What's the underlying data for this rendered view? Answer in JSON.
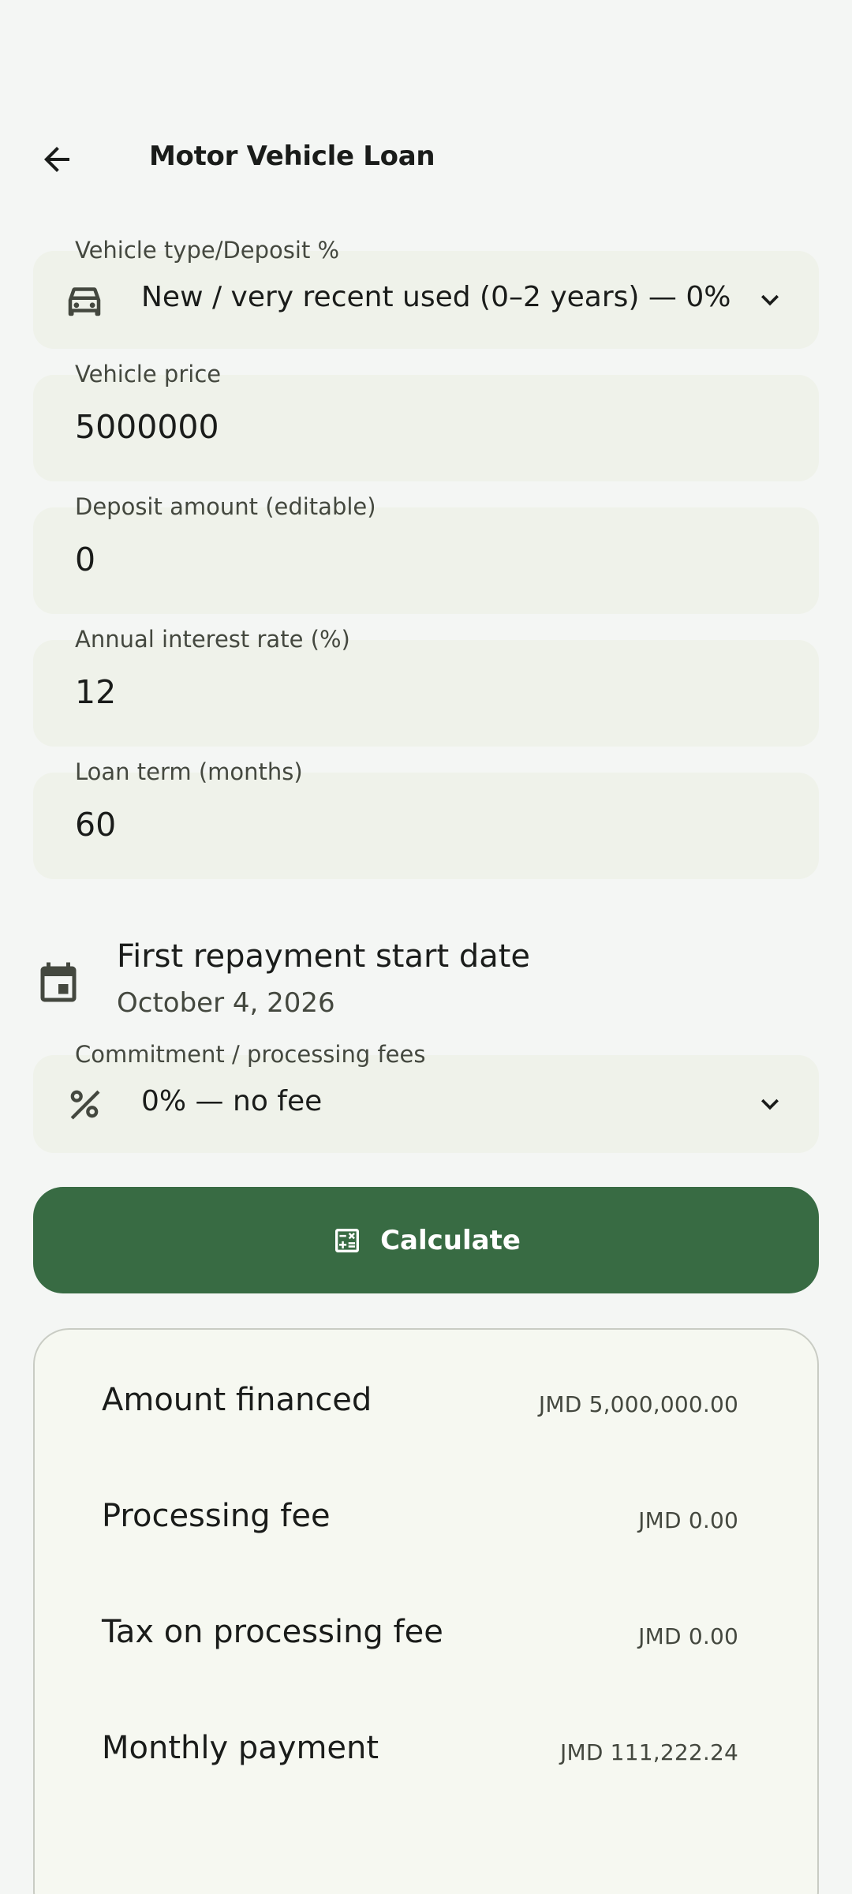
{
  "header": {
    "title": "Motor Vehicle Loan",
    "back_icon": "arrow-left-icon"
  },
  "vehicle_type": {
    "label": "Vehicle type/Deposit %",
    "value": "New / very recent used (0–2 years) — 0%",
    "icon": "car-icon"
  },
  "vehicle_price": {
    "label": "Vehicle price",
    "value": "5000000"
  },
  "deposit": {
    "label": "Deposit amount (editable)",
    "value": "0"
  },
  "interest": {
    "label": "Annual interest rate (%)",
    "value": "12"
  },
  "term": {
    "label": "Loan term (months)",
    "value": "60"
  },
  "start_date": {
    "title": "First repayment start date",
    "value": "October 4, 2026",
    "icon": "calendar-icon"
  },
  "fees": {
    "label": "Commitment / processing fees",
    "value": "0% — no fee",
    "icon": "percent-icon"
  },
  "calculate": {
    "label": "Calculate",
    "icon": "calculator-icon"
  },
  "results": [
    {
      "label": "Amount financed",
      "value": "JMD 5,000,000.00"
    },
    {
      "label": "Processing fee",
      "value": "JMD 0.00"
    },
    {
      "label": "Tax on processing fee",
      "value": "JMD 0.00"
    },
    {
      "label": "Monthly payment",
      "value": "JMD 111,222.24"
    }
  ],
  "colors": {
    "primary": "#386b43",
    "field_bg": "#eff2ea",
    "background": "#f4f6f4"
  }
}
